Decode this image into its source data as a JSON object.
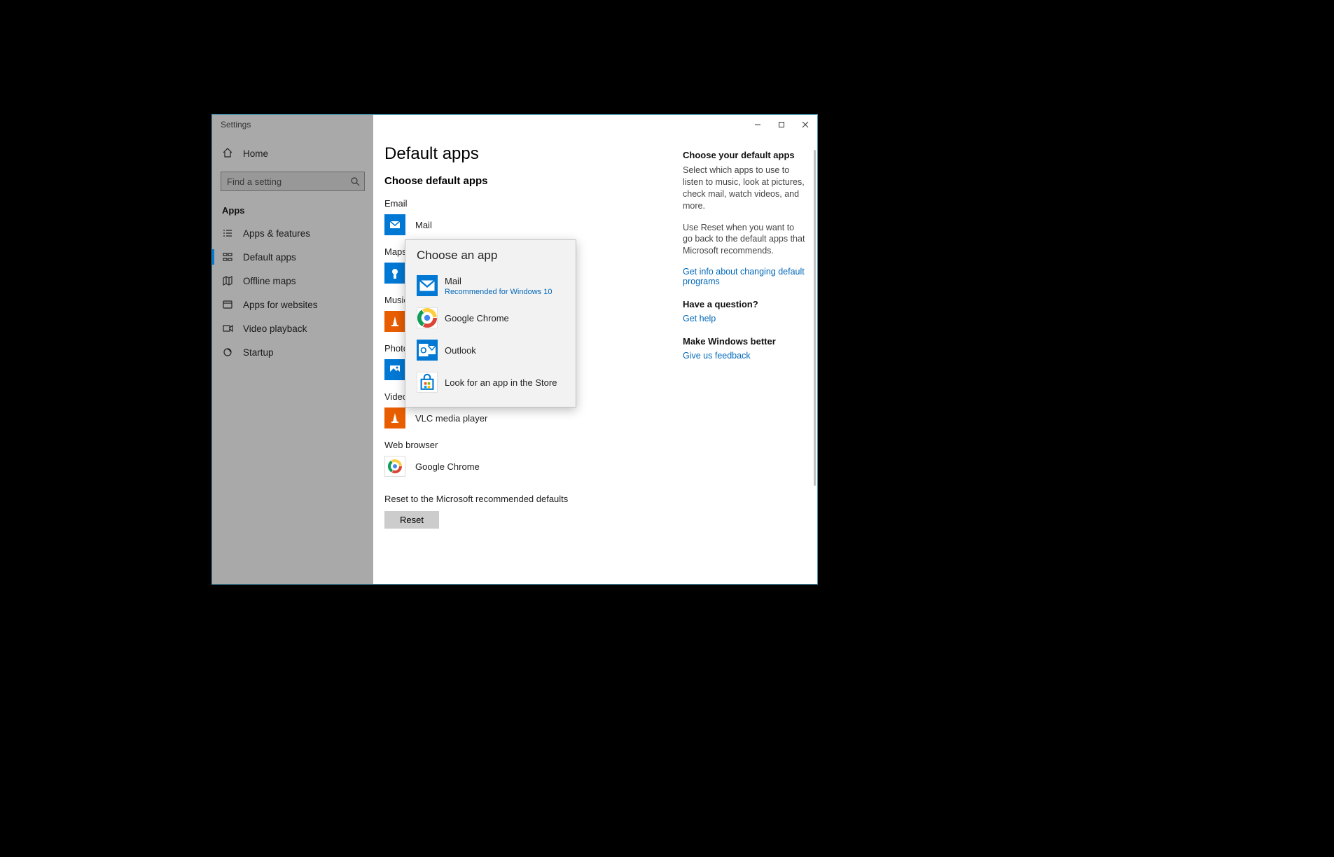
{
  "window": {
    "title": "Settings"
  },
  "sidebar": {
    "home": "Home",
    "search_placeholder": "Find a setting",
    "category": "Apps",
    "items": [
      {
        "label": "Apps & features"
      },
      {
        "label": "Default apps"
      },
      {
        "label": "Offline maps"
      },
      {
        "label": "Apps for websites"
      },
      {
        "label": "Video playback"
      },
      {
        "label": "Startup"
      }
    ]
  },
  "main": {
    "title": "Default apps",
    "heading": "Choose default apps",
    "categories": [
      {
        "label": "Email",
        "app": "Mail"
      },
      {
        "label": "Maps",
        "app": ""
      },
      {
        "label": "Music player",
        "app": ""
      },
      {
        "label": "Photo viewer",
        "app": ""
      },
      {
        "label": "Video player",
        "app": "VLC media player"
      },
      {
        "label": "Web browser",
        "app": "Google Chrome"
      }
    ],
    "reset_text": "Reset to the Microsoft recommended defaults",
    "reset_button": "Reset"
  },
  "popup": {
    "title": "Choose an app",
    "options": [
      {
        "label": "Mail",
        "sub": "Recommended for Windows 10"
      },
      {
        "label": "Google Chrome",
        "sub": ""
      },
      {
        "label": "Outlook",
        "sub": ""
      },
      {
        "label": "Look for an app in the Store",
        "sub": ""
      }
    ]
  },
  "right": {
    "h1": "Choose your default apps",
    "p1": "Select which apps to use to listen to music, look at pictures, check mail, watch videos, and more.",
    "p2": "Use Reset when you want to go back to the default apps that Microsoft recommends.",
    "link1": "Get info about changing default programs",
    "h2": "Have a question?",
    "link2": "Get help",
    "h3": "Make Windows better",
    "link3": "Give us feedback"
  }
}
